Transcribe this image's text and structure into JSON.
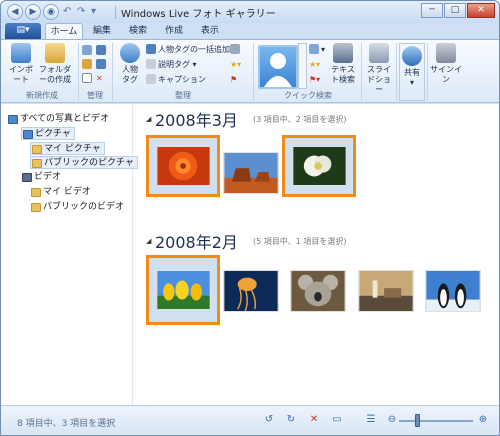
{
  "window": {
    "title": "Windows Live フォト ギャラリー",
    "buttons": {
      "minimize": "─",
      "maximize": "□",
      "close": "✕"
    }
  },
  "quick_access": {
    "back": "◀",
    "forward": "▶",
    "undo": "↶",
    "redo": "↷",
    "customize": "▾"
  },
  "app_button_label": "▤▾",
  "tabs": [
    "ホーム",
    "編集",
    "検索",
    "作成",
    "表示"
  ],
  "ribbon": {
    "groups": {
      "new": "新規作成",
      "manage": "管理",
      "organize": "整理",
      "quick_search": "クイック検索"
    },
    "import_label": "インポート",
    "new_folder_label": "フォルダーの作成",
    "people_tag_label": "人物タグ",
    "people_tag_bulk": "人物タグの一括追加",
    "description_tag": "説明タグ",
    "caption": "キャプション",
    "text_search_label": "テキスト検索",
    "slideshow_label": "スライドショー",
    "share_label": "共有",
    "signin_label": "サインイン"
  },
  "nav": {
    "items": [
      {
        "label": "すべての写真とビデオ",
        "icon": "all-media-icon"
      },
      {
        "label": "ピクチャ",
        "icon": "pictures-icon"
      },
      {
        "label": "マイ ピクチャ",
        "icon": "folder-icon"
      },
      {
        "label": "パブリックのピクチャ",
        "icon": "folder-icon"
      },
      {
        "label": "ビデオ",
        "icon": "video-icon"
      },
      {
        "label": "マイ ビデオ",
        "icon": "folder-icon"
      },
      {
        "label": "パブリックのビデオ",
        "icon": "folder-icon"
      }
    ]
  },
  "sections": [
    {
      "title": "2008年3月",
      "info": "(3 項目中、2 項目を選択)",
      "thumbnails": [
        {
          "name": "red-flower",
          "selected": true
        },
        {
          "name": "desert-mesa",
          "selected": false
        },
        {
          "name": "white-flower",
          "selected": true
        }
      ]
    },
    {
      "title": "2008年2月",
      "info": "(5 項目中、1 項目を選択)",
      "thumbnails": [
        {
          "name": "yellow-tulips",
          "selected": true
        },
        {
          "name": "jellyfish",
          "selected": false
        },
        {
          "name": "koala",
          "selected": false
        },
        {
          "name": "lighthouse",
          "selected": false
        },
        {
          "name": "penguins",
          "selected": false
        }
      ]
    }
  ],
  "status": {
    "text": "8 項目中、3 項目を選択",
    "zoom_out": "⊖",
    "zoom_in": "⊕"
  },
  "colors": {
    "selection_border": "#f08c1a",
    "accent": "#1f4f98"
  }
}
